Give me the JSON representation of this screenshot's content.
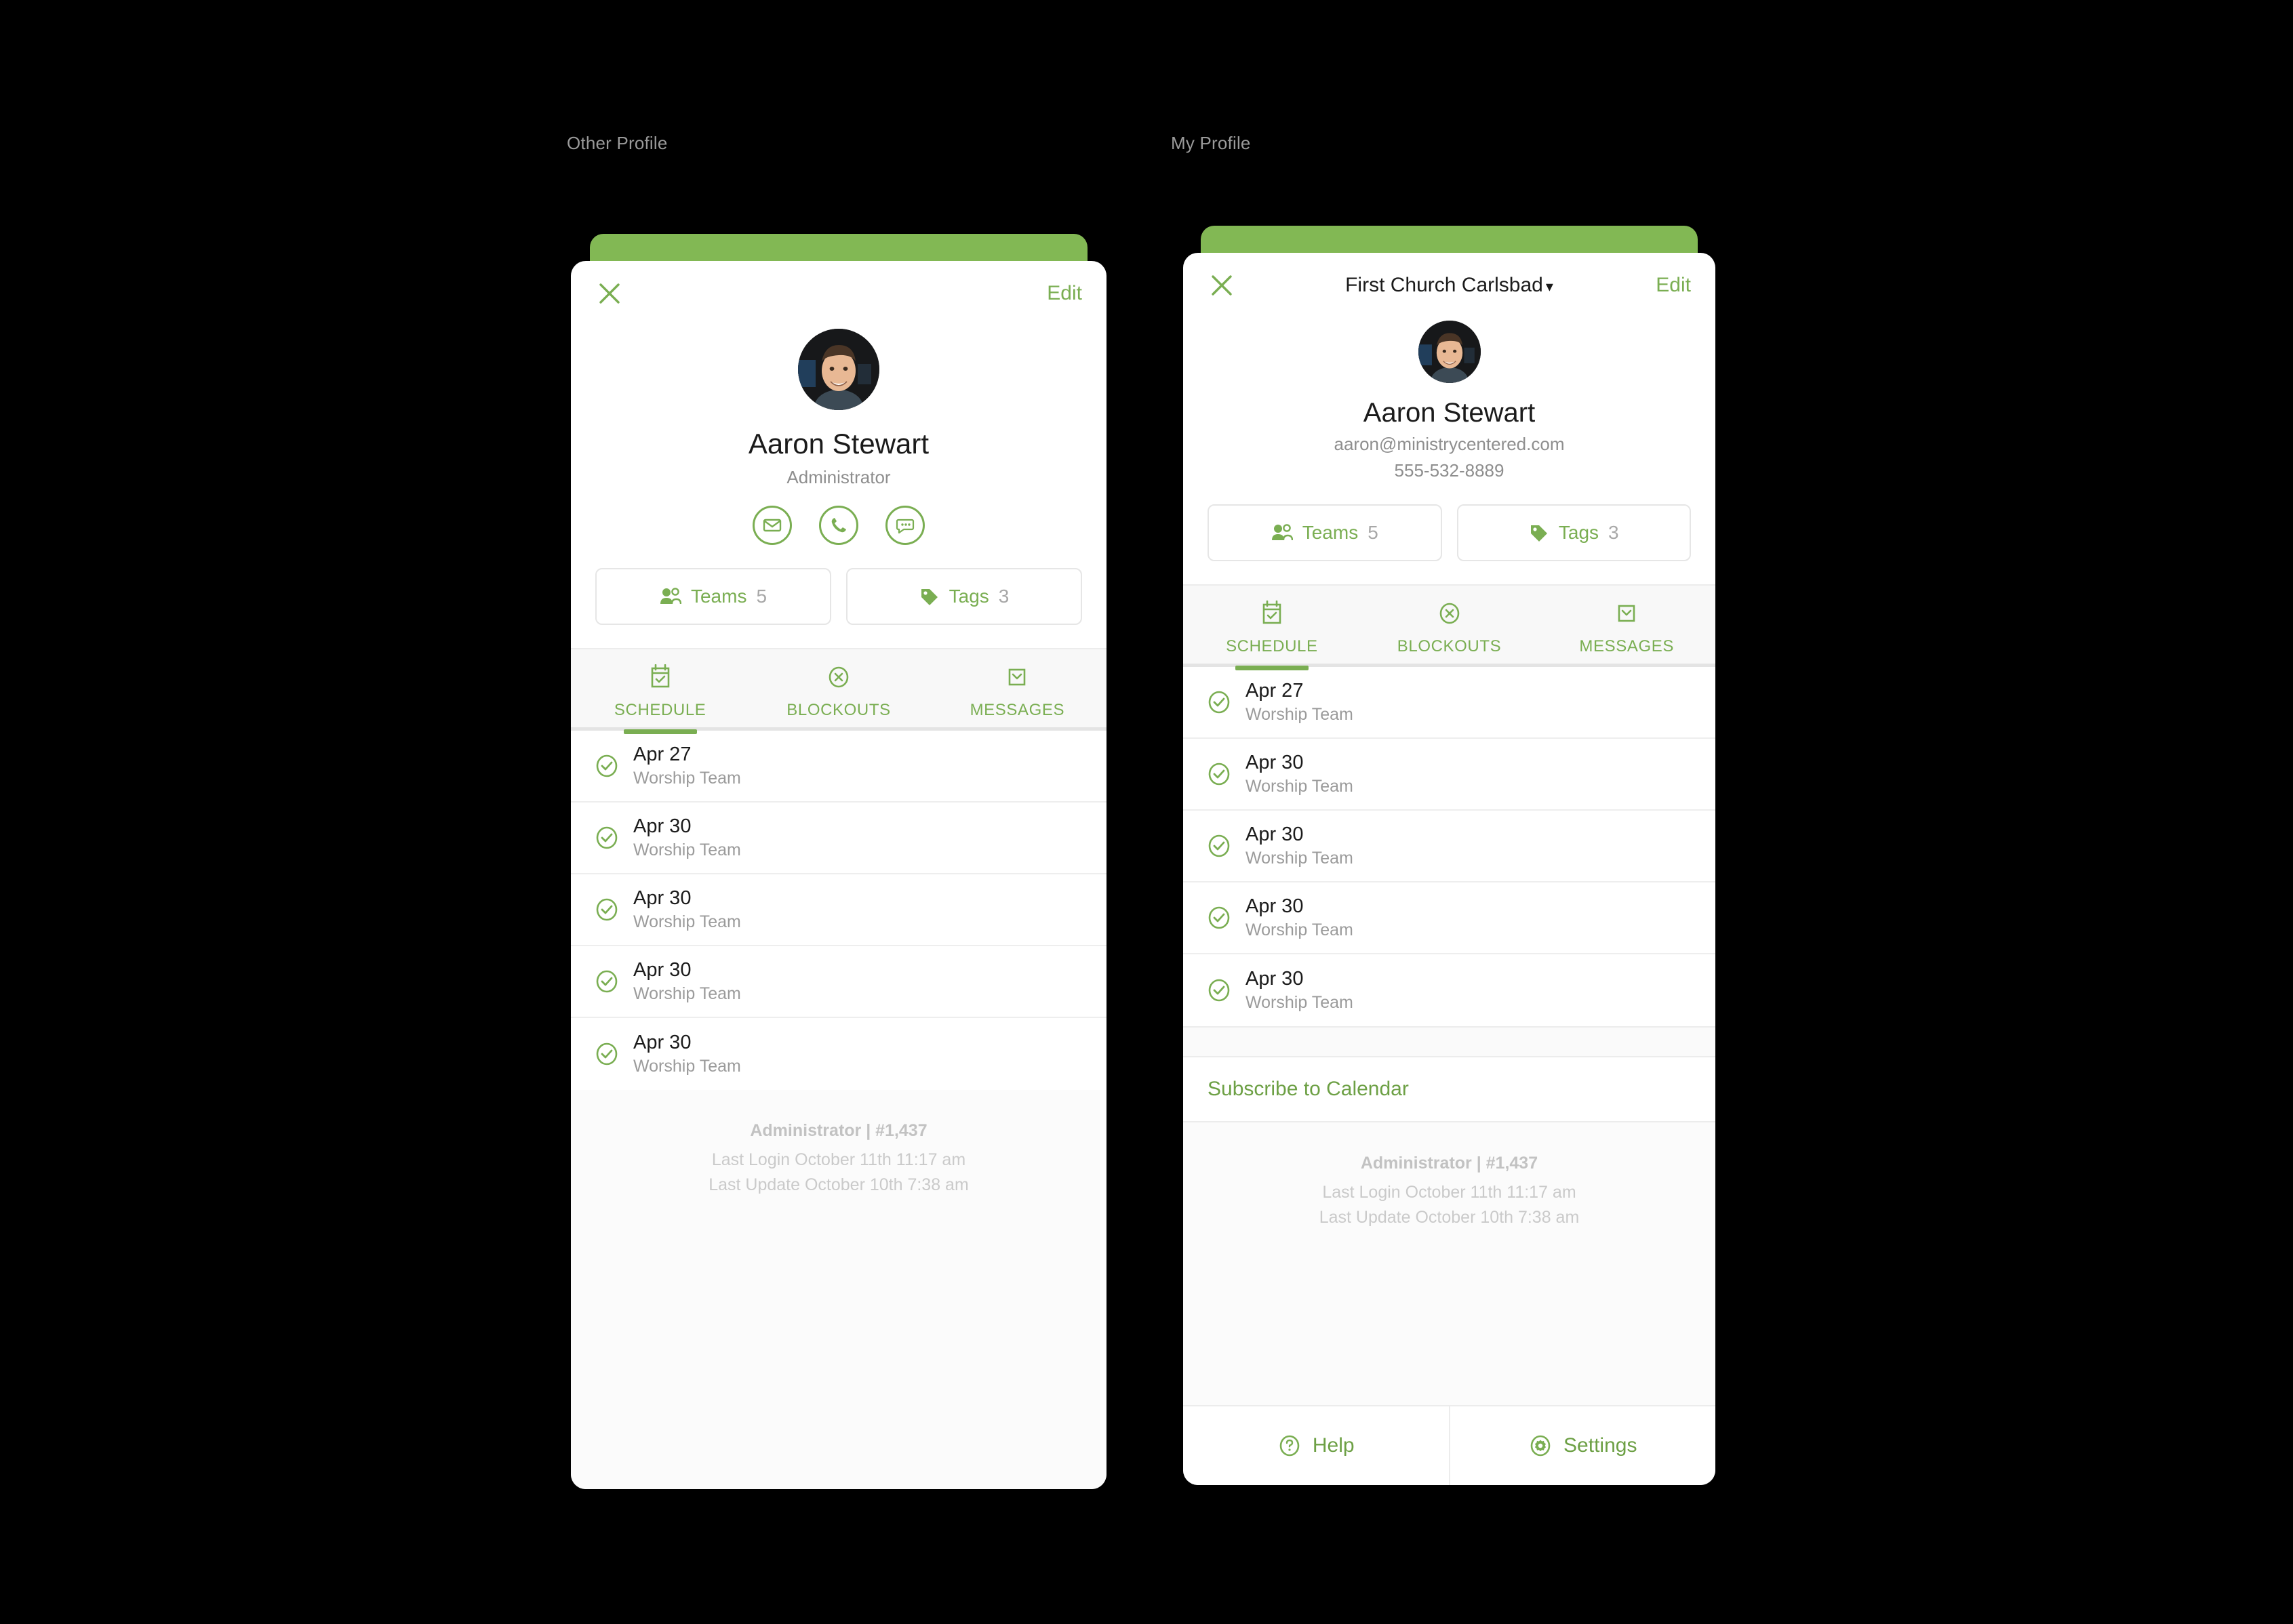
{
  "captions": {
    "left": "Other Profile",
    "right": "My Profile"
  },
  "theme": {
    "accent_green": "#82b854",
    "link_green": "#6da045",
    "icon_green": "#7aae52",
    "muted_gray": "#9b9b9b",
    "page_background": "#000000"
  },
  "left_phone": {
    "topbar": {
      "close_icon": "close-icon",
      "title": "",
      "edit_label": "Edit"
    },
    "profile": {
      "avatar_icon": "avatar-photo",
      "name": "Aaron Stewart",
      "subtitle": "Administrator",
      "contact_actions": [
        {
          "icon": "mail-icon",
          "name": "email-action"
        },
        {
          "icon": "phone-icon",
          "name": "call-action"
        },
        {
          "icon": "chat-icon",
          "name": "message-action"
        }
      ],
      "chips": [
        {
          "icon": "teams-icon",
          "label": "Teams",
          "count": "5"
        },
        {
          "icon": "tag-icon",
          "label": "Tags",
          "count": "3"
        }
      ]
    },
    "tabs": [
      {
        "label": "SCHEDULE",
        "icon": "calendar-check-icon",
        "active": true
      },
      {
        "label": "BLOCKOUTS",
        "icon": "circle-x-icon",
        "active": false
      },
      {
        "label": "MESSAGES",
        "icon": "envelope-icon",
        "active": false
      }
    ],
    "schedule": [
      {
        "date": "Apr 27",
        "team": "Worship Team",
        "status_icon": "check-circle-icon"
      },
      {
        "date": "Apr 30",
        "team": "Worship Team",
        "status_icon": "check-circle-icon"
      },
      {
        "date": "Apr 30",
        "team": "Worship Team",
        "status_icon": "check-circle-icon"
      },
      {
        "date": "Apr 30",
        "team": "Worship Team",
        "status_icon": "check-circle-icon"
      },
      {
        "date": "Apr 30",
        "team": "Worship Team",
        "status_icon": "check-circle-icon"
      }
    ],
    "meta": {
      "role_line": "Administrator | #1,437",
      "last_login": "Last Login October 11th 11:17 am",
      "last_update": "Last Update October 10th 7:38 am"
    }
  },
  "right_phone": {
    "topbar": {
      "close_icon": "close-icon",
      "title": "First Church Carlsbad",
      "title_caret": "▾",
      "edit_label": "Edit"
    },
    "profile": {
      "avatar_icon": "avatar-photo",
      "name": "Aaron Stewart",
      "email": "aaron@ministrycentered.com",
      "phone": "555-532-8889",
      "chips": [
        {
          "icon": "teams-icon",
          "label": "Teams",
          "count": "5"
        },
        {
          "icon": "tag-icon",
          "label": "Tags",
          "count": "3"
        }
      ]
    },
    "tabs": [
      {
        "label": "SCHEDULE",
        "icon": "calendar-check-icon",
        "active": true
      },
      {
        "label": "BLOCKOUTS",
        "icon": "circle-x-icon",
        "active": false
      },
      {
        "label": "MESSAGES",
        "icon": "envelope-icon",
        "active": false
      }
    ],
    "schedule": [
      {
        "date": "Apr 27",
        "team": "Worship Team",
        "status_icon": "check-circle-icon"
      },
      {
        "date": "Apr 30",
        "team": "Worship Team",
        "status_icon": "check-circle-icon"
      },
      {
        "date": "Apr 30",
        "team": "Worship Team",
        "status_icon": "check-circle-icon"
      },
      {
        "date": "Apr 30",
        "team": "Worship Team",
        "status_icon": "check-circle-icon"
      },
      {
        "date": "Apr 30",
        "team": "Worship Team",
        "status_icon": "check-circle-icon"
      }
    ],
    "subscribe_label": "Subscribe to Calendar",
    "meta": {
      "role_line": "Administrator | #1,437",
      "last_login": "Last Login October 11th 11:17 am",
      "last_update": "Last Update October 10th 7:38 am"
    },
    "bottom_actions": [
      {
        "icon": "help-circle-icon",
        "label": "Help"
      },
      {
        "icon": "gear-circle-icon",
        "label": "Settings"
      }
    ]
  }
}
